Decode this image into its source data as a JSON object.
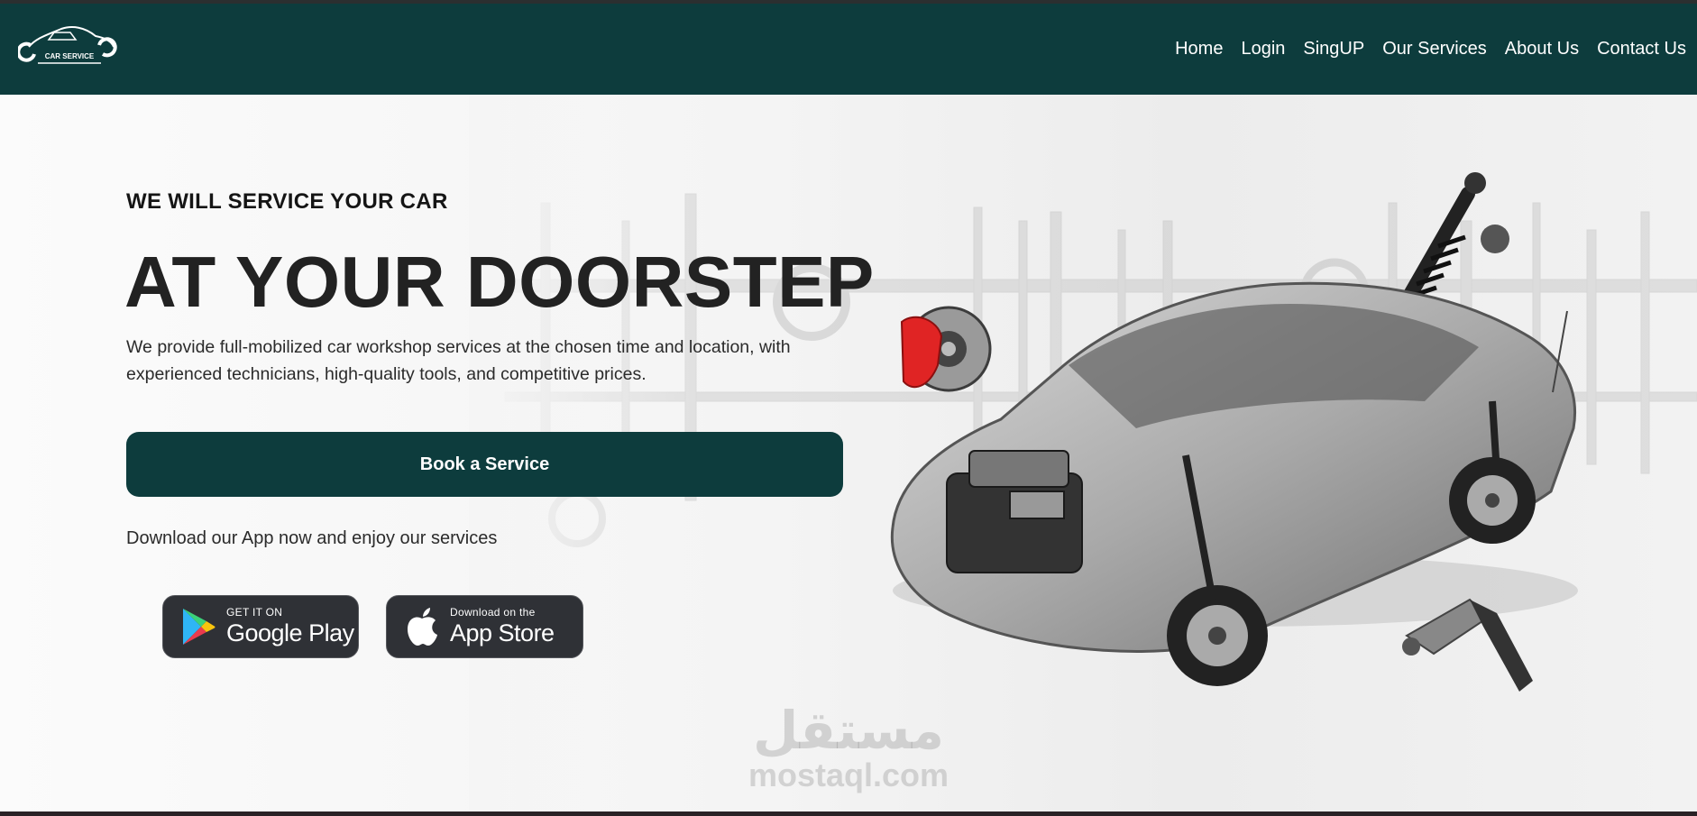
{
  "brand": {
    "logo_text": "CAR SERVICE"
  },
  "nav": {
    "items": [
      {
        "label": "Home"
      },
      {
        "label": "Login"
      },
      {
        "label": "SingUP"
      },
      {
        "label": "Our Services"
      },
      {
        "label": "About Us"
      },
      {
        "label": "Contact Us"
      }
    ]
  },
  "hero": {
    "subtitle": "WE WILL SERVICE YOUR CAR",
    "headline": "AT YOUR DOORSTEP",
    "description": "We provide full-mobilized car workshop services at the chosen time and location, with experienced technicians, high-quality tools, and competitive prices.",
    "cta_label": "Book a Service",
    "download_text": "Download our App now and enjoy our services"
  },
  "badges": {
    "google": {
      "small": "GET IT ON",
      "big": "Google Play",
      "icon": "google-play-icon"
    },
    "apple": {
      "small": "Download on the",
      "big": "App Store",
      "icon": "apple-icon"
    }
  },
  "watermark": {
    "arabic": "مستقل",
    "latin": "mostaql.com"
  },
  "colors": {
    "primary": "#0d3c3d",
    "badge_bg": "#2f3136",
    "text": "#222222"
  }
}
